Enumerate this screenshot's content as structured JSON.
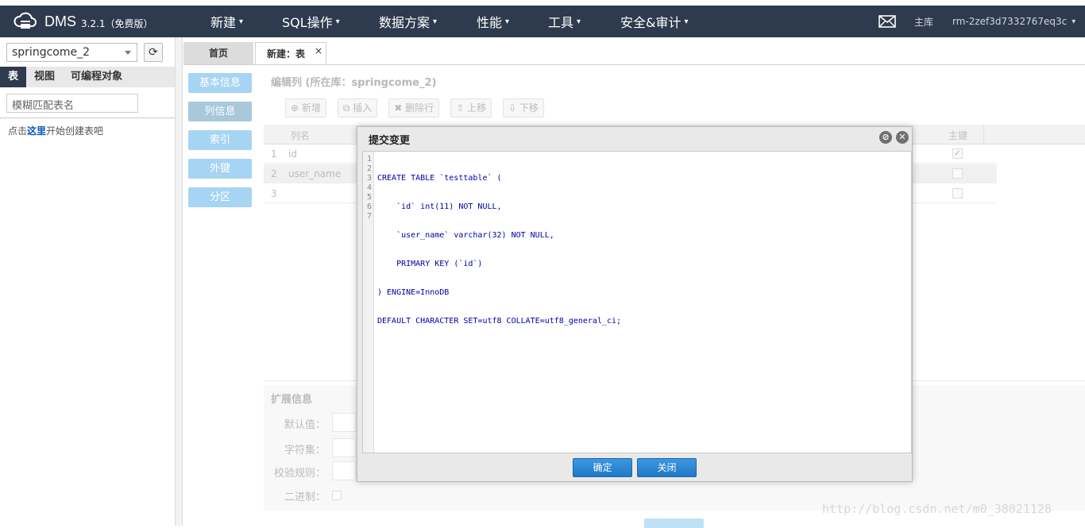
{
  "header": {
    "app_name": "DMS",
    "version": "3.2.1（免费版）",
    "menus": [
      "新建",
      "SQL操作",
      "数据方案",
      "性能",
      "工具",
      "安全&审计"
    ],
    "instance_role": "主库",
    "instance_id": "rm-2zef3d7332767eq3c"
  },
  "sidebar": {
    "database": "springcome_2",
    "tabs": [
      "表",
      "视图",
      "可编程对象"
    ],
    "search_placeholder": "模糊匹配表名",
    "hint_prefix": "点击",
    "hint_link": "这里",
    "hint_suffix": "开始创建表吧"
  },
  "tabs": {
    "home": "首页",
    "current": "新建：表"
  },
  "nav": [
    "基本信息",
    "列信息",
    "索引",
    "外键",
    "分区"
  ],
  "editor": {
    "title": "编辑列 (所在库：springcome_2)",
    "toolbar": [
      "新增",
      "插入",
      "删除行",
      "上移",
      "下移"
    ],
    "col_name_header": "列名",
    "col_pk_header": "主键",
    "rows": [
      {
        "num": "1",
        "name": "id"
      },
      {
        "num": "2",
        "name": "user_name"
      },
      {
        "num": "3",
        "name": ""
      }
    ]
  },
  "ext": {
    "title": "扩展信息",
    "fields": [
      "默认值：",
      "字符集：",
      "校验规则：",
      "二进制："
    ]
  },
  "dialog": {
    "title": "提交变更",
    "line_numbers": [
      "1",
      "2",
      "3",
      "4",
      "5",
      "6",
      "7"
    ],
    "code_lines": [
      "CREATE TABLE `testtable` (",
      "    `id` int(11) NOT NULL,",
      "    `user_name` varchar(32) NOT NULL,",
      "    PRIMARY KEY (`id`)",
      ") ENGINE=InnoDB",
      "DEFAULT CHARACTER SET=utf8 COLLATE=utf8_general_ci;",
      ""
    ],
    "ok_label": "确定",
    "close_label": "关闭"
  },
  "watermark": "http://blog.csdn.net/m0_38021128",
  "colors": {
    "topbar": "#2e3a4d",
    "accent": "#1e78c6",
    "nav_button": "#a6d4f3"
  }
}
